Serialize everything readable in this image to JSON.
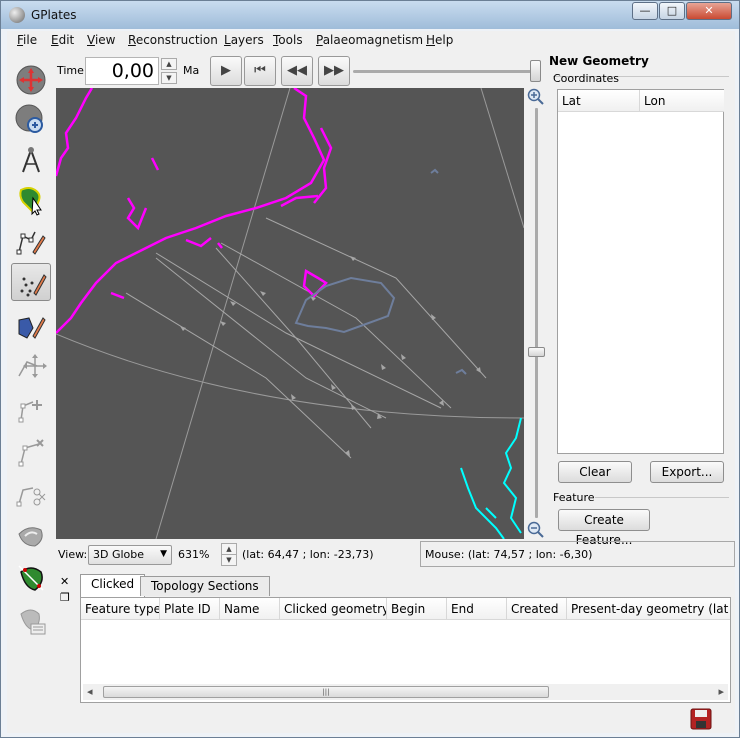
{
  "window": {
    "title": "GPlates",
    "minimize": "—",
    "maximize": "□",
    "close": "✕"
  },
  "menu": [
    "File",
    "Edit",
    "View",
    "Reconstruction",
    "Layers",
    "Tools",
    "Palaeomagnetism",
    "Help"
  ],
  "toolbox": [
    {
      "name": "drag-globe-tool-icon",
      "active": false
    },
    {
      "name": "zoom-globe-tool-icon",
      "active": false
    },
    {
      "name": "measure-distance-tool-icon",
      "active": false
    },
    {
      "name": "choose-feature-tool-icon",
      "active": false
    },
    {
      "name": "digitise-polyline-tool-icon",
      "active": false
    },
    {
      "name": "digitise-multipoint-tool-icon",
      "active": true
    },
    {
      "name": "digitise-polygon-tool-icon",
      "active": false
    },
    {
      "name": "move-vertex-tool-icon",
      "active": false
    },
    {
      "name": "insert-vertex-tool-icon",
      "active": false
    },
    {
      "name": "delete-vertex-tool-icon",
      "active": false
    },
    {
      "name": "split-feature-tool-icon",
      "active": false
    },
    {
      "name": "manipulate-pole-tool-icon",
      "active": false
    },
    {
      "name": "build-topology-tool-icon",
      "active": false
    },
    {
      "name": "edit-topology-tool-icon",
      "active": false
    }
  ],
  "timebar": {
    "time_label": "Time:",
    "time_value": "0,00",
    "unit": "Ma",
    "play": "▶",
    "rewind": "⏮",
    "step_back": "◀◀",
    "step_forward": "▶▶"
  },
  "right_panel": {
    "title": "New Geometry",
    "coordinates_label": "Coordinates",
    "columns": [
      "Lat",
      "Lon"
    ],
    "clear_button": "Clear",
    "export_button": "Export...",
    "feature_label": "Feature",
    "create_feature_button": "Create Feature..."
  },
  "status": {
    "view_label": "View:",
    "view_mode": "3D Globe",
    "zoom": "631%",
    "camera_position": "(lat: 64,47 ; lon: -23,73)",
    "mouse_position": "Mouse: (lat: 74,57 ; lon: -6,30)"
  },
  "bottom_panel": {
    "tabs": [
      "Clicked",
      "Topology Sections"
    ],
    "columns": [
      "Feature type",
      "Plate ID",
      "Name",
      "Clicked geometry",
      "Begin",
      "End",
      "Created",
      "Present-day geometry (lat ; lo"
    ],
    "close_icon": "✕",
    "float_icon": "❐",
    "scroll_grip": "|||",
    "scroll_left": "◂",
    "scroll_right": "▸"
  },
  "colors": {
    "globe_bg": "#555555",
    "greenland": "#ff00ff",
    "europe": "#00ffff",
    "iceland": "#6e7e9c",
    "flowlines": "#a6a6a6"
  }
}
